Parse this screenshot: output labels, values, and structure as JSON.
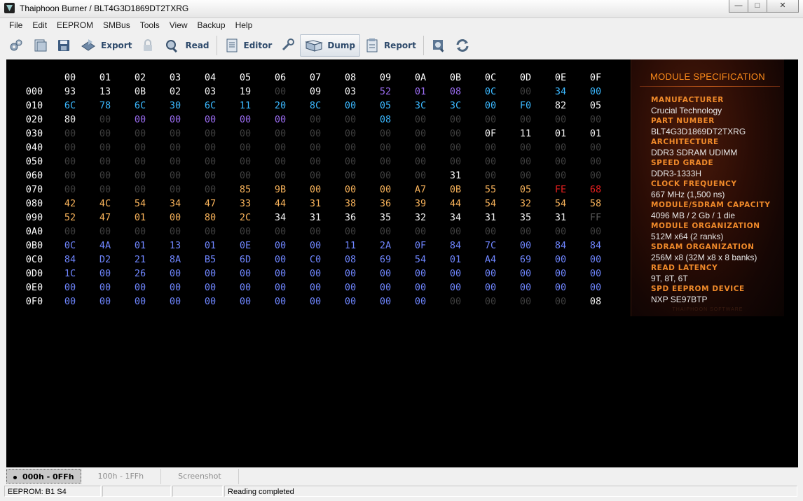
{
  "window": {
    "title": "Thaiphoon Burner / BLT4G3D1869DT2TXRG",
    "min_icon": "minimize-icon",
    "max_icon": "maximize-icon",
    "close_icon": "close-icon"
  },
  "menu": [
    "File",
    "Edit",
    "EEPROM",
    "SMBus",
    "Tools",
    "View",
    "Backup",
    "Help"
  ],
  "toolbar": {
    "export": "Export",
    "read": "Read",
    "editor": "Editor",
    "dump": "Dump",
    "report": "Report"
  },
  "hex": {
    "columns": [
      "00",
      "01",
      "02",
      "03",
      "04",
      "05",
      "06",
      "07",
      "08",
      "09",
      "0A",
      "0B",
      "0C",
      "0D",
      "0E",
      "0F"
    ],
    "rows": [
      {
        "addr": "000",
        "bytes": [
          "93",
          "13",
          "0B",
          "02",
          "03",
          "19",
          "00",
          "09",
          "03",
          "52",
          "01",
          "08",
          "0C",
          "00",
          "34",
          "00"
        ]
      },
      {
        "addr": "010",
        "bytes": [
          "6C",
          "78",
          "6C",
          "30",
          "6C",
          "11",
          "20",
          "8C",
          "00",
          "05",
          "3C",
          "3C",
          "00",
          "F0",
          "82",
          "05"
        ]
      },
      {
        "addr": "020",
        "bytes": [
          "80",
          "00",
          "00",
          "00",
          "00",
          "00",
          "00",
          "00",
          "00",
          "08",
          "00",
          "00",
          "00",
          "00",
          "00",
          "00"
        ]
      },
      {
        "addr": "030",
        "bytes": [
          "00",
          "00",
          "00",
          "00",
          "00",
          "00",
          "00",
          "00",
          "00",
          "00",
          "00",
          "00",
          "0F",
          "11",
          "01",
          "01"
        ]
      },
      {
        "addr": "040",
        "bytes": [
          "00",
          "00",
          "00",
          "00",
          "00",
          "00",
          "00",
          "00",
          "00",
          "00",
          "00",
          "00",
          "00",
          "00",
          "00",
          "00"
        ]
      },
      {
        "addr": "050",
        "bytes": [
          "00",
          "00",
          "00",
          "00",
          "00",
          "00",
          "00",
          "00",
          "00",
          "00",
          "00",
          "00",
          "00",
          "00",
          "00",
          "00"
        ]
      },
      {
        "addr": "060",
        "bytes": [
          "00",
          "00",
          "00",
          "00",
          "00",
          "00",
          "00",
          "00",
          "00",
          "00",
          "00",
          "31",
          "00",
          "00",
          "00",
          "00"
        ]
      },
      {
        "addr": "070",
        "bytes": [
          "00",
          "00",
          "00",
          "00",
          "00",
          "85",
          "9B",
          "00",
          "00",
          "00",
          "A7",
          "0B",
          "55",
          "05",
          "FE",
          "68"
        ]
      },
      {
        "addr": "080",
        "bytes": [
          "42",
          "4C",
          "54",
          "34",
          "47",
          "33",
          "44",
          "31",
          "38",
          "36",
          "39",
          "44",
          "54",
          "32",
          "54",
          "58"
        ]
      },
      {
        "addr": "090",
        "bytes": [
          "52",
          "47",
          "01",
          "00",
          "80",
          "2C",
          "34",
          "31",
          "36",
          "35",
          "32",
          "34",
          "31",
          "35",
          "31",
          "FF"
        ]
      },
      {
        "addr": "0A0",
        "bytes": [
          "00",
          "00",
          "00",
          "00",
          "00",
          "00",
          "00",
          "00",
          "00",
          "00",
          "00",
          "00",
          "00",
          "00",
          "00",
          "00"
        ]
      },
      {
        "addr": "0B0",
        "bytes": [
          "0C",
          "4A",
          "01",
          "13",
          "01",
          "0E",
          "00",
          "00",
          "11",
          "2A",
          "0F",
          "84",
          "7C",
          "00",
          "84",
          "84"
        ]
      },
      {
        "addr": "0C0",
        "bytes": [
          "84",
          "D2",
          "21",
          "8A",
          "B5",
          "6D",
          "00",
          "C0",
          "08",
          "69",
          "54",
          "01",
          "A4",
          "69",
          "00",
          "00"
        ]
      },
      {
        "addr": "0D0",
        "bytes": [
          "1C",
          "00",
          "26",
          "00",
          "00",
          "00",
          "00",
          "00",
          "00",
          "00",
          "00",
          "00",
          "00",
          "00",
          "00",
          "00"
        ]
      },
      {
        "addr": "0E0",
        "bytes": [
          "00",
          "00",
          "00",
          "00",
          "00",
          "00",
          "00",
          "00",
          "00",
          "00",
          "00",
          "00",
          "00",
          "00",
          "00",
          "00"
        ]
      },
      {
        "addr": "0F0",
        "bytes": [
          "00",
          "00",
          "00",
          "00",
          "00",
          "00",
          "00",
          "00",
          "00",
          "00",
          "00",
          "00",
          "00",
          "00",
          "00",
          "08"
        ]
      }
    ],
    "colors": [
      [
        "white",
        "white",
        "white",
        "white",
        "white",
        "white",
        "gray",
        "white",
        "white",
        "violet",
        "violet",
        "violet",
        "cyan",
        "gray",
        "cyan",
        "cyan"
      ],
      [
        "cyan",
        "cyan",
        "cyan",
        "cyan",
        "cyan",
        "cyan",
        "cyan",
        "cyan",
        "cyan",
        "cyan",
        "cyan",
        "cyan",
        "cyan",
        "cyan",
        "white",
        "white"
      ],
      [
        "white",
        "gray",
        "violet",
        "violet",
        "violet",
        "violet",
        "violet",
        "gray",
        "gray",
        "cyan",
        "gray",
        "gray",
        "gray",
        "gray",
        "gray",
        "gray"
      ],
      [
        "gray",
        "gray",
        "gray",
        "gray",
        "gray",
        "gray",
        "gray",
        "gray",
        "gray",
        "gray",
        "gray",
        "gray",
        "white",
        "white",
        "white",
        "white"
      ],
      [
        "gray",
        "gray",
        "gray",
        "gray",
        "gray",
        "gray",
        "gray",
        "gray",
        "gray",
        "gray",
        "gray",
        "gray",
        "gray",
        "gray",
        "gray",
        "gray"
      ],
      [
        "gray",
        "gray",
        "gray",
        "gray",
        "gray",
        "gray",
        "gray",
        "gray",
        "gray",
        "gray",
        "gray",
        "gray",
        "gray",
        "gray",
        "gray",
        "gray"
      ],
      [
        "gray",
        "gray",
        "gray",
        "gray",
        "gray",
        "gray",
        "gray",
        "gray",
        "gray",
        "gray",
        "gray",
        "white",
        "gray",
        "gray",
        "gray",
        "gray"
      ],
      [
        "gray",
        "gray",
        "gray",
        "gray",
        "gray",
        "orange",
        "orange",
        "orange",
        "orange",
        "orange",
        "orange",
        "orange",
        "orange",
        "orange",
        "red",
        "red"
      ],
      [
        "orange",
        "orange",
        "orange",
        "orange",
        "orange",
        "orange",
        "orange",
        "orange",
        "orange",
        "orange",
        "orange",
        "orange",
        "orange",
        "orange",
        "orange",
        "orange"
      ],
      [
        "orange",
        "orange",
        "orange",
        "orange",
        "orange",
        "orange",
        "white",
        "white",
        "white",
        "white",
        "white",
        "white",
        "white",
        "white",
        "white",
        "dim"
      ],
      [
        "gray",
        "gray",
        "gray",
        "gray",
        "gray",
        "gray",
        "gray",
        "gray",
        "gray",
        "gray",
        "gray",
        "gray",
        "gray",
        "gray",
        "gray",
        "gray"
      ],
      [
        "blue",
        "blue",
        "blue",
        "blue",
        "blue",
        "blue",
        "blue",
        "blue",
        "blue",
        "blue",
        "blue",
        "blue",
        "blue",
        "blue",
        "blue",
        "blue"
      ],
      [
        "blue",
        "blue",
        "blue",
        "blue",
        "blue",
        "blue",
        "blue",
        "blue",
        "blue",
        "blue",
        "blue",
        "blue",
        "blue",
        "blue",
        "blue",
        "blue"
      ],
      [
        "blue",
        "blue",
        "blue",
        "blue",
        "blue",
        "blue",
        "blue",
        "blue",
        "blue",
        "blue",
        "blue",
        "blue",
        "blue",
        "blue",
        "blue",
        "blue"
      ],
      [
        "blue",
        "blue",
        "blue",
        "blue",
        "blue",
        "blue",
        "blue",
        "blue",
        "blue",
        "blue",
        "blue",
        "blue",
        "blue",
        "blue",
        "blue",
        "blue"
      ],
      [
        "blue",
        "blue",
        "blue",
        "blue",
        "blue",
        "blue",
        "blue",
        "blue",
        "blue",
        "blue",
        "blue",
        "gray",
        "gray",
        "gray",
        "gray",
        "white"
      ]
    ]
  },
  "spec": {
    "title": "MODULE SPECIFICATION",
    "items": [
      {
        "label": "MANUFACTURER",
        "value": "Crucial Technology"
      },
      {
        "label": "PART NUMBER",
        "value": "BLT4G3D1869DT2TXRG"
      },
      {
        "label": "ARCHITECTURE",
        "value": "DDR3 SDRAM UDIMM"
      },
      {
        "label": "SPEED GRADE",
        "value": "DDR3-1333H"
      },
      {
        "label": "CLOCK FREQUENCY",
        "value": "667 MHz (1,500 ns)"
      },
      {
        "label": "MODULE/SDRAM CAPACITY",
        "value": "4096 MB / 2 Gb / 1 die"
      },
      {
        "label": "MODULE ORGANIZATION",
        "value": "512M x64 (2 ranks)"
      },
      {
        "label": "SDRAM ORGANIZATION",
        "value": "256M x8 (32M x8 x 8 banks)"
      },
      {
        "label": "READ LATENCY",
        "value": "9T, 8T, 6T"
      },
      {
        "label": "SPD EEPROM DEVICE",
        "value": "NXP SE97BTP"
      }
    ],
    "watermark": "THAIPHOON SOFTWARE"
  },
  "tabs": [
    "000h - 0FFh",
    "100h - 1FFh",
    "Screenshot"
  ],
  "status": {
    "eeprom": "EEPROM: B1 S4",
    "blank1": "",
    "blank2": "",
    "message": "Reading completed"
  }
}
